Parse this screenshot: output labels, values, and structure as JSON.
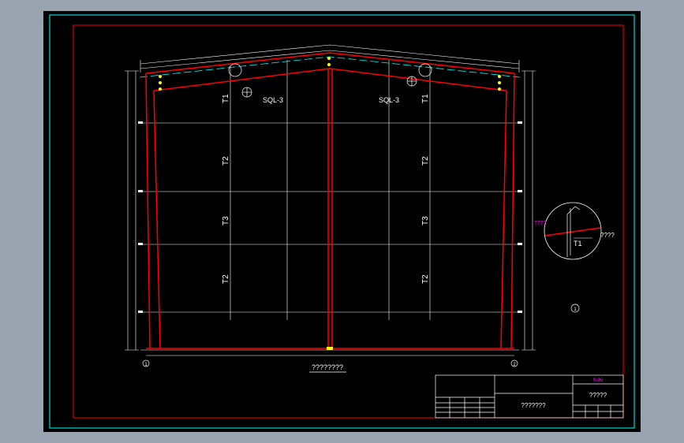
{
  "drawing": {
    "main_label": "????????",
    "purlin_left": "SQL-3",
    "purlin_right": "SQL-3",
    "brace_labels": [
      "T1",
      "T2",
      "T3",
      "T2"
    ],
    "detail": {
      "left_note": "????",
      "right_note": "????",
      "member": "T1",
      "marker": "1"
    },
    "grid_left": "1",
    "grid_right": "2"
  },
  "title_block": {
    "sheet_no": "S-06",
    "project": "?????",
    "drawing_title": "???????"
  },
  "colors": {
    "background": "#000000",
    "frame": "#ff0000",
    "outer_border": "#00ffff",
    "grid": "#ffffff",
    "annotation_magenta": "#ff00ff",
    "bolts": "#ffff00"
  }
}
